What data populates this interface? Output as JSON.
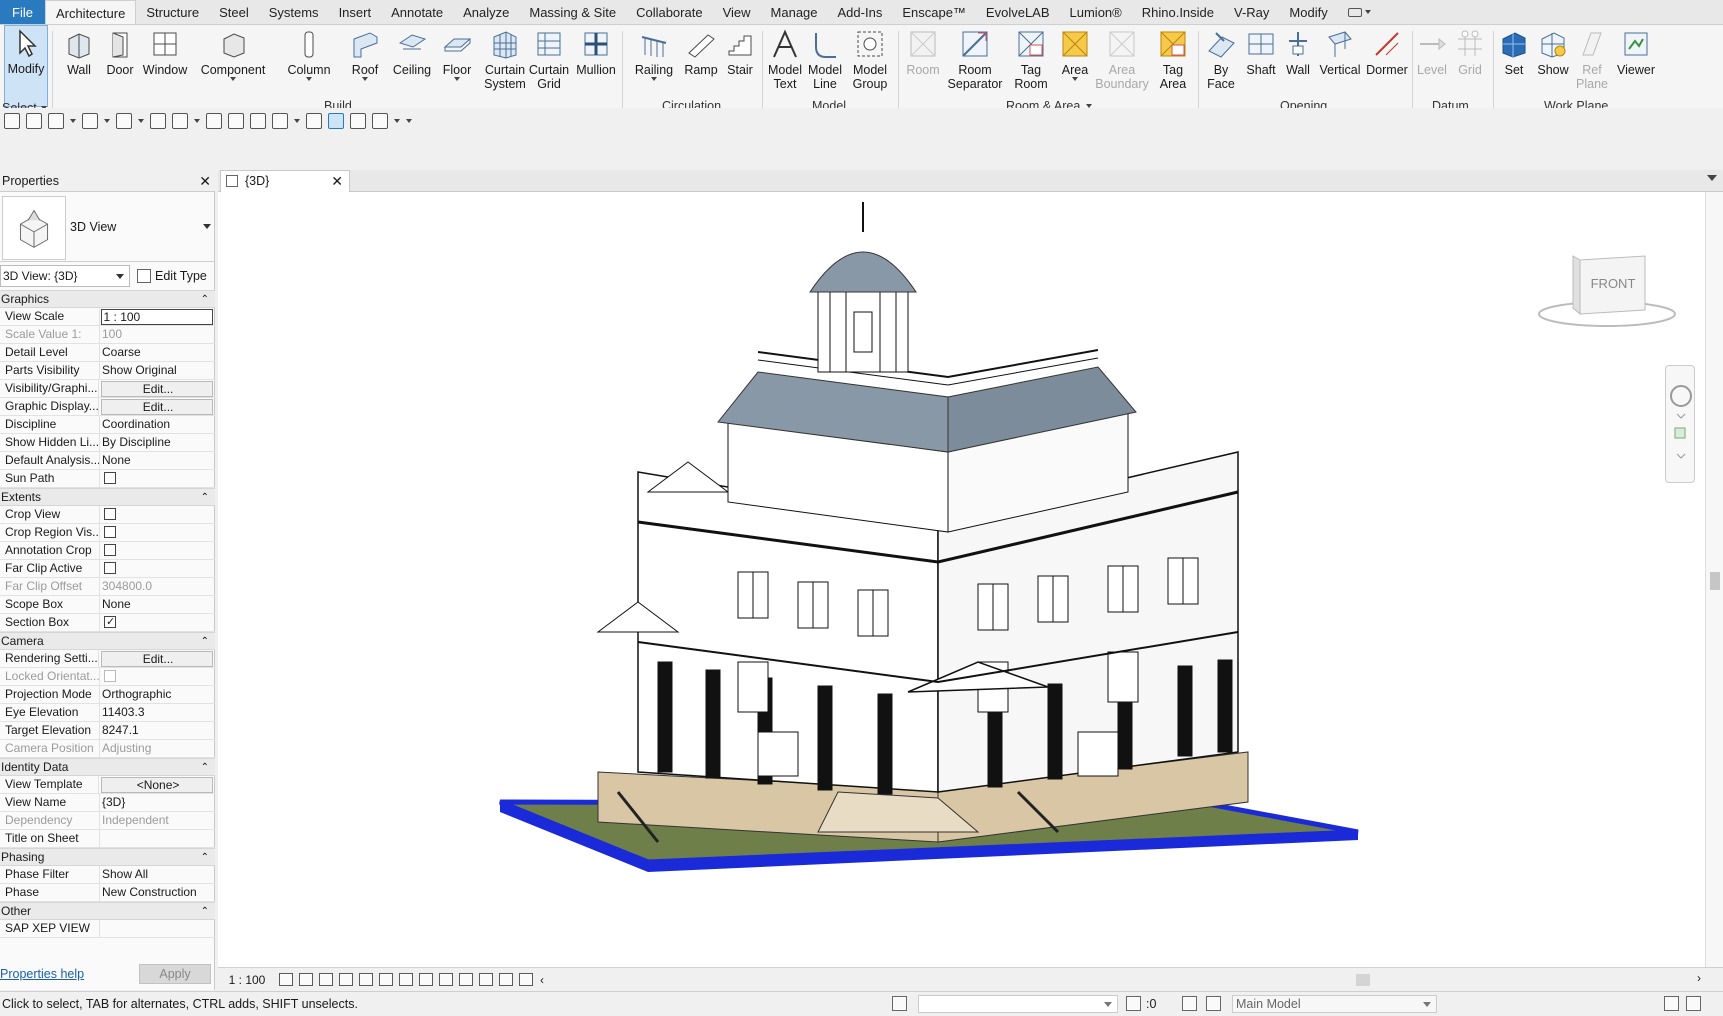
{
  "tabs": [
    "File",
    "Architecture",
    "Structure",
    "Steel",
    "Systems",
    "Insert",
    "Annotate",
    "Analyze",
    "Massing & Site",
    "Collaborate",
    "View",
    "Manage",
    "Add-Ins",
    "Enscape™",
    "EvolveLAB",
    "Lumion®",
    "Rhino.Inside",
    "V-Ray",
    "Modify"
  ],
  "active_tab": "Architecture",
  "ribbon": {
    "select_label": "Select",
    "groups": {
      "build": "Build",
      "circulation": "Circulation",
      "model": "Model",
      "room_area": "Room & Area",
      "opening": "Opening",
      "datum": "Datum",
      "work_plane": "Work Plane"
    },
    "buttons": {
      "modify": "Modify",
      "wall": "Wall",
      "door": "Door",
      "window": "Window",
      "component": "Component",
      "column": "Column",
      "roof": "Roof",
      "ceiling": "Ceiling",
      "floor": "Floor",
      "curtain_system": [
        "Curtain",
        "System"
      ],
      "curtain_grid": [
        "Curtain",
        "Grid"
      ],
      "mullion": "Mullion",
      "railing": "Railing",
      "ramp": "Ramp",
      "stair": "Stair",
      "model_text": [
        "Model",
        "Text"
      ],
      "model_line": [
        "Model",
        "Line"
      ],
      "model_group": [
        "Model",
        "Group"
      ],
      "room": "Room",
      "room_separator": [
        "Room",
        "Separator"
      ],
      "tag_room": [
        "Tag",
        "Room"
      ],
      "area": "Area",
      "area_boundary": [
        "Area",
        "Boundary"
      ],
      "tag_area": [
        "Tag",
        "Area"
      ],
      "by_face": [
        "By",
        "Face"
      ],
      "shaft": "Shaft",
      "wall_opening": "Wall",
      "vertical": "Vertical",
      "dormer": "Dormer",
      "level": "Level",
      "grid": "Grid",
      "set": "Set",
      "show": "Show",
      "ref_plane": [
        "Ref",
        "Plane"
      ],
      "viewer": "Viewer"
    }
  },
  "properties": {
    "title": "Properties",
    "type_name": "3D View",
    "instance_selector": "3D View: {3D}",
    "edit_type": "Edit Type",
    "categories": [
      {
        "name": "Graphics",
        "rows": [
          {
            "name": "View Scale",
            "value": "1 : 100",
            "kind": "input"
          },
          {
            "name": "Scale Value    1:",
            "value": "100",
            "kind": "ro"
          },
          {
            "name": "Detail Level",
            "value": "Coarse"
          },
          {
            "name": "Parts Visibility",
            "value": "Show Original"
          },
          {
            "name": "Visibility/Graphi...",
            "value": "Edit...",
            "kind": "btn"
          },
          {
            "name": "Graphic Display...",
            "value": "Edit...",
            "kind": "btn"
          },
          {
            "name": "Discipline",
            "value": "Coordination"
          },
          {
            "name": "Show Hidden Li...",
            "value": "By Discipline"
          },
          {
            "name": "Default Analysis...",
            "value": "None"
          },
          {
            "name": "Sun Path",
            "value": "",
            "kind": "chk",
            "checked": false
          }
        ]
      },
      {
        "name": "Extents",
        "rows": [
          {
            "name": "Crop View",
            "value": "",
            "kind": "chk",
            "checked": false
          },
          {
            "name": "Crop Region Vis...",
            "value": "",
            "kind": "chk",
            "checked": false
          },
          {
            "name": "Annotation Crop",
            "value": "",
            "kind": "chk",
            "checked": false
          },
          {
            "name": "Far Clip Active",
            "value": "",
            "kind": "chk",
            "checked": false
          },
          {
            "name": "Far Clip Offset",
            "value": "304800.0",
            "kind": "ro"
          },
          {
            "name": "Scope Box",
            "value": "None"
          },
          {
            "name": "Section Box",
            "value": "",
            "kind": "chk",
            "checked": true
          }
        ]
      },
      {
        "name": "Camera",
        "rows": [
          {
            "name": "Rendering Setti...",
            "value": "Edit...",
            "kind": "btn"
          },
          {
            "name": "Locked Orientat...",
            "value": "",
            "kind": "chkro",
            "checked": false
          },
          {
            "name": "Projection Mode",
            "value": "Orthographic"
          },
          {
            "name": "Eye Elevation",
            "value": "11403.3"
          },
          {
            "name": "Target Elevation",
            "value": "8247.1"
          },
          {
            "name": "Camera Position",
            "value": "Adjusting",
            "kind": "ro"
          }
        ]
      },
      {
        "name": "Identity Data",
        "rows": [
          {
            "name": "View Template",
            "value": "<None>",
            "kind": "btn"
          },
          {
            "name": "View Name",
            "value": "{3D}"
          },
          {
            "name": "Dependency",
            "value": "Independent",
            "kind": "ro"
          },
          {
            "name": "Title on Sheet",
            "value": ""
          }
        ]
      },
      {
        "name": "Phasing",
        "rows": [
          {
            "name": "Phase Filter",
            "value": "Show All"
          },
          {
            "name": "Phase",
            "value": "New Construction"
          }
        ]
      },
      {
        "name": "Other",
        "rows": [
          {
            "name": "SAP XEP VIEW",
            "value": ""
          }
        ]
      }
    ],
    "help_link": "Properties help",
    "apply": "Apply"
  },
  "view": {
    "tab_label": "{3D}",
    "scale_label": "1 : 100",
    "viewcube_face": "FRONT"
  },
  "status": {
    "message": "Click to select, TAB for alternates, CTRL adds, SHIFT unselects.",
    "selection_count": ":0",
    "model_dropdown": "Main Model"
  },
  "colors": {
    "file_tab": "#2a7ac0",
    "roof": "#8898a6",
    "ground": "#6e7f4a",
    "base_edge": "#1a2ad8"
  }
}
